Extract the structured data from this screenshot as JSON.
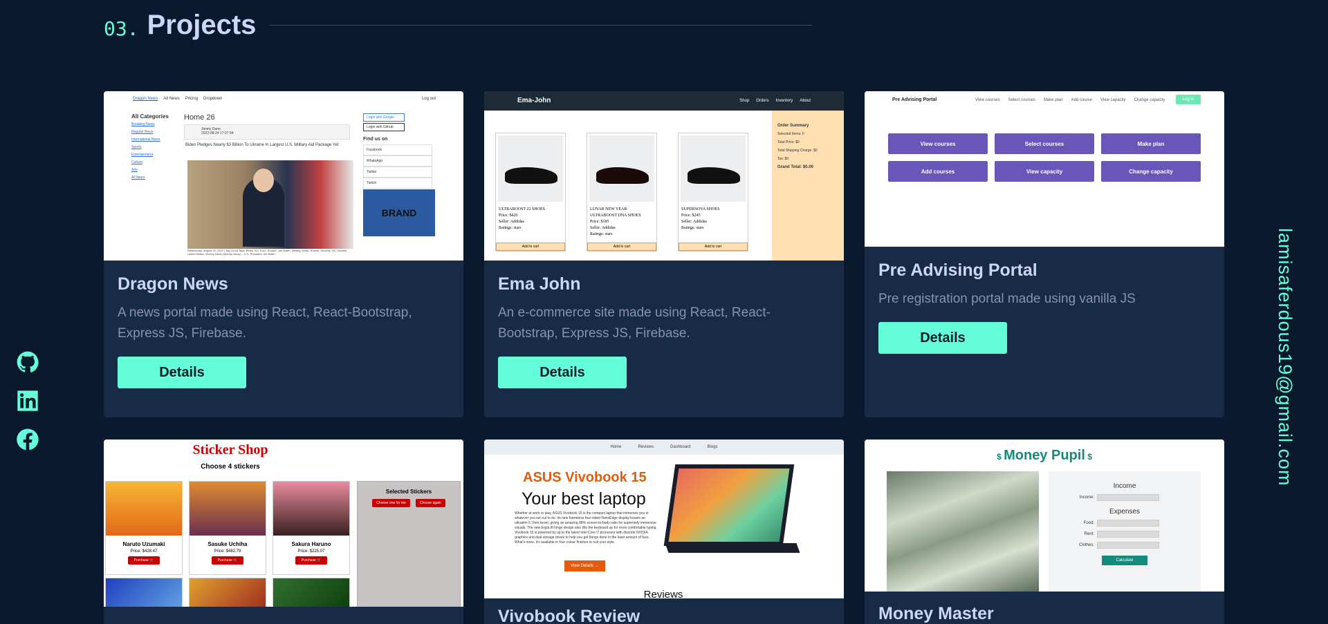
{
  "section": {
    "number": "03.",
    "title": "Projects"
  },
  "email": "lamisaferdous19@gmail.com",
  "social_icons": [
    "github-icon",
    "linkedin-icon",
    "facebook-icon"
  ],
  "accent_color": "#64ffda",
  "projects": [
    {
      "title": "Dragon News",
      "description": "A news portal made using React, React-Bootstrap, Express JS, Firebase.",
      "button": "Details",
      "preview": {
        "nav": [
          "Dragon News",
          "All News",
          "Pricing",
          "Dropdown"
        ],
        "logout": "Log out",
        "categories_title": "All Categories",
        "categories": [
          "Breaking News",
          "Regular News",
          "International News",
          "Sports",
          "Entertainment",
          "Culture",
          "Arts",
          "All News"
        ],
        "page_heading": "Home 26",
        "author": "Jimmy Dane",
        "date": "2022-08-24 17:27:34",
        "headline": "Biden Pledges Nearly $3 Billion To Ukraine In Largest U.S. Military Aid Package Yet",
        "caption": "Wednesday, August 24, 2022 | Tag Cloud Tags: Biden, EU, Euro, Europe, Joe Biden, Military, News, Russia, Security, UK, Ukraine, United States, Worthy News (Worthy News) – U.S. President Joe Biden",
        "login_google": "Login with Google",
        "login_github": "Login with Github",
        "find_us": "Find us on",
        "find_links": [
          "Facebook",
          "WhatsApp",
          "Twitter",
          "Twitch"
        ],
        "brand": "BRAND"
      }
    },
    {
      "title": "Ema John",
      "description": "An e-commerce site made using React, React-Bootstrap, Express JS, Firebase.",
      "button": "Details",
      "preview": {
        "logo": "Ema-John",
        "nav": [
          "Shop",
          "Orders",
          "Inventory",
          "About"
        ],
        "products": [
          {
            "name": "ULTRABOOST 22 SHOES",
            "price": "Price: $420",
            "seller": "Seller: Addidas",
            "rating": "Ratings: stars",
            "cta": "Add to cart"
          },
          {
            "name": "LUNAR NEW YEAR ULTRABOOST DNA SHOES",
            "price": "Price: $185",
            "seller": "Seller: Addidas",
            "rating": "Ratings: stars",
            "cta": "Add to cart"
          },
          {
            "name": "SUPERNOVA SHOES",
            "price": "Price: $245",
            "seller": "Seller: Addidas",
            "rating": "Ratings: stars",
            "cta": "Add to cart"
          }
        ],
        "summary": [
          "Order Summary",
          "Selected Items: 0",
          "Total Price: $0",
          "Total Shipping Charge: $0",
          "Tax: $0",
          "Grand Total: $0.00"
        ]
      }
    },
    {
      "title": "Pre Advising Portal",
      "description": "Pre registration portal made using vanilla JS",
      "button": "Details",
      "preview": {
        "logo": "Pre Advising Portal",
        "nav": [
          "View courses",
          "Select courses",
          "Make plan",
          "Add course",
          "View capacity",
          "Change capacity"
        ],
        "login": "Log in",
        "buttons": [
          "View courses",
          "Select courses",
          "Make plan",
          "Add courses",
          "View capacity",
          "Change capacity"
        ]
      }
    },
    {
      "title": "",
      "preview": {
        "title": "Sticker Shop",
        "subtitle": "Choose 4 stickers",
        "stickers": [
          {
            "name": "Naruto Uzumaki",
            "price": "Price: $428.47",
            "cta": "Purchase 🛒"
          },
          {
            "name": "Sasuke Uchiha",
            "price": "Price: $482.79",
            "cta": "Purchase 🛒"
          },
          {
            "name": "Sakura Haruno",
            "price": "Price: $225.07",
            "cta": "Purchase 🛒"
          }
        ],
        "selected_title": "Selected Stickers",
        "choose_one": "Choose one for me",
        "choose_again": "Choose again"
      }
    },
    {
      "title": "Vivobook Review",
      "preview": {
        "nav": [
          "Home",
          "Reviews",
          "Dashboard",
          "Blogs"
        ],
        "product": "ASUS Vivobook 15",
        "tagline": "Your best laptop",
        "text": "Whether at work or play, ASUS Vivobook 15 is the compact laptop that immerses you in whatever you set out to do. Its new frameless four-sided NanoEdge display boasts an ultraslim 5.7mm bezel, giving an amazing 88% screen-to-body ratio for supremely immersive visuals. The new ErgoLift hinge design also tilts the keyboard up for more comfortable typing. Vivobook 15 is powered by up to the latest Intel Core i7 processor with discrete NVIDIA graphics and dual storage drives to help you get things done in the least amount of fuss. What's more, it's available in four colour finishes to suit your style.",
        "cta": "View Details →",
        "reviews_heading": "Reviews"
      }
    },
    {
      "title": "Money Master",
      "preview": {
        "title": "Money Pupil",
        "income_heading": "Income",
        "income_label": "Income:",
        "expenses_heading": "Expenses",
        "expense_labels": [
          "Food:",
          "Rent:",
          "Clothes:"
        ],
        "calculate": "Calculate"
      }
    }
  ]
}
